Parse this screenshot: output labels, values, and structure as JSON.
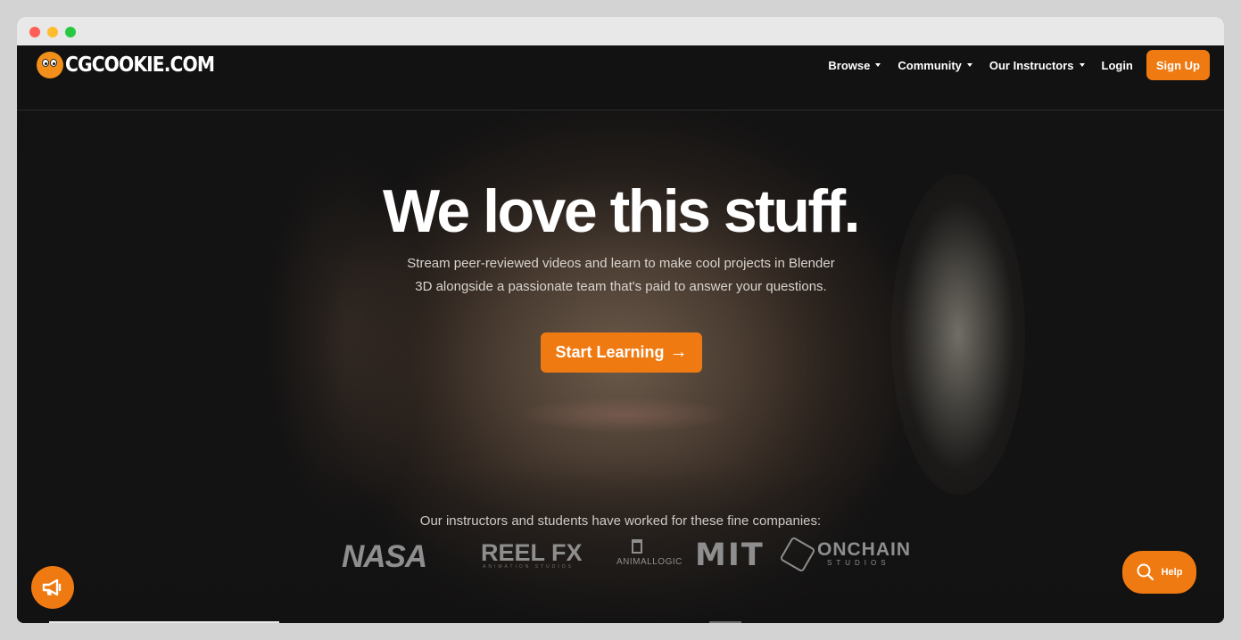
{
  "brand": {
    "name": "CGCOOKIE.COM",
    "accent": "#f07a12"
  },
  "nav": {
    "items": [
      {
        "label": "Browse",
        "dropdown": true
      },
      {
        "label": "Community",
        "dropdown": true
      },
      {
        "label": "Our Instructors",
        "dropdown": true
      }
    ],
    "login": "Login",
    "signup": "Sign Up"
  },
  "hero": {
    "headline": "We love this stuff.",
    "subtext": "Stream peer-reviewed videos and learn to make cool projects in Blender 3D alongside a passionate team that's paid to answer your questions.",
    "cta": "Start Learning",
    "cta_arrow": "→"
  },
  "companies": {
    "label": "Our instructors and students have worked for these fine companies:",
    "logos": [
      {
        "name": "NASA"
      },
      {
        "name": "REEL FX",
        "sub": "ANIMATION STUDIOS"
      },
      {
        "name": "ANIMALLOGIC"
      },
      {
        "name": "MIT"
      },
      {
        "name": "ONCHAIN",
        "sub": "STUDIOS"
      }
    ]
  },
  "widgets": {
    "help_label": "Help",
    "announce_icon": "megaphone-icon",
    "help_icon": "search-icon"
  }
}
